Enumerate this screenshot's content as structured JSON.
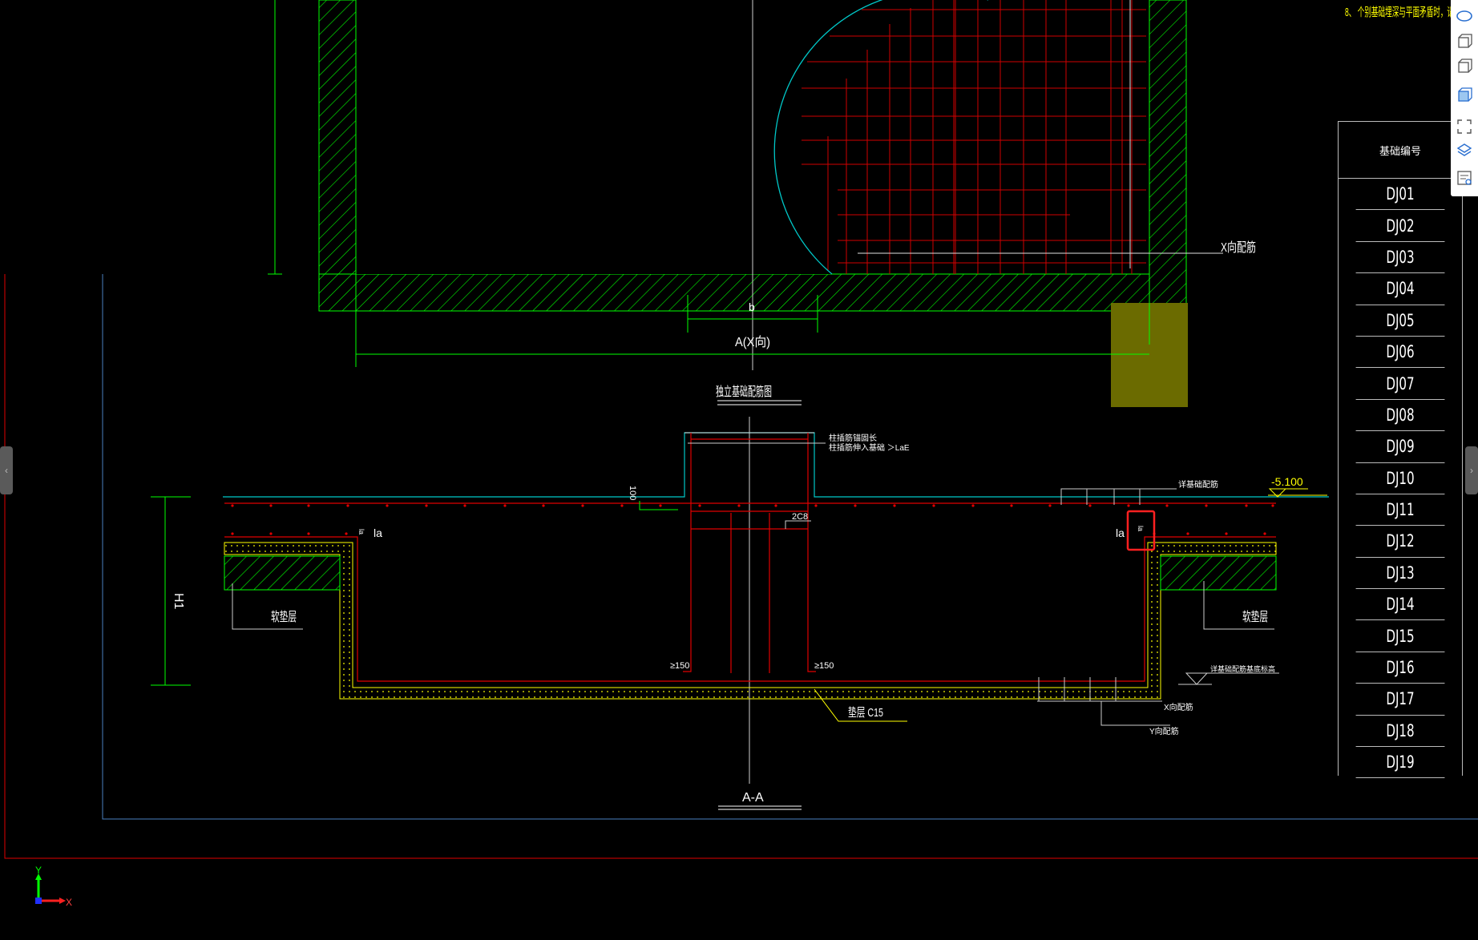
{
  "notes": {
    "note8": "8、 个别基础埋深与平面矛盾时，请"
  },
  "plan": {
    "x_rebar_label": "X向配筋",
    "b_label": "b",
    "a_dim_label": "A(X向)",
    "drawing_title": "独立基础配筋图"
  },
  "section": {
    "top_note_line1": "柱插筋锚固长",
    "top_note_line2": "柱插筋伸入基础 ＞LaE",
    "dim_100": "100",
    "c8_label": "2C8",
    "la_left": "la",
    "la_right": "la",
    "la_small_left": "la",
    "la_small_right": "la",
    "h1_label": "H1",
    "soft_cushion_left": "软垫层",
    "soft_cushion_right": "软垫层",
    "ge150_left": "≥150",
    "ge150_right": "≥150",
    "cushion_c15": "垫层 C15",
    "bottom_rebar_note": "详基础配筋",
    "elevation": "-5.100",
    "bottom_elev_note": "详基础配筋基底标高",
    "x_rebar": "X向配筋",
    "y_rebar": "Y向配筋",
    "title": "A-A"
  },
  "table": {
    "header": "基础编号",
    "rows": [
      "DJ01",
      "DJ02",
      "DJ03",
      "DJ04",
      "DJ05",
      "DJ06",
      "DJ07",
      "DJ08",
      "DJ09",
      "DJ10",
      "DJ11",
      "DJ12",
      "DJ13",
      "DJ14",
      "DJ15",
      "DJ16",
      "DJ17",
      "DJ18",
      "DJ19"
    ]
  },
  "ucs": {
    "x_label": "X",
    "y_label": "Y"
  },
  "toolbar": {
    "icons": [
      "ellipse-3d-icon",
      "cube-3d-icon",
      "cube-view-icon",
      "cube-solid-icon",
      "fullscreen-icon",
      "layer-icon",
      "properties-icon"
    ]
  },
  "colors": {
    "background": "#000000",
    "green": "#00ff00",
    "red": "#ff0000",
    "cyan": "#00ffff",
    "yellow": "#ffff00"
  }
}
